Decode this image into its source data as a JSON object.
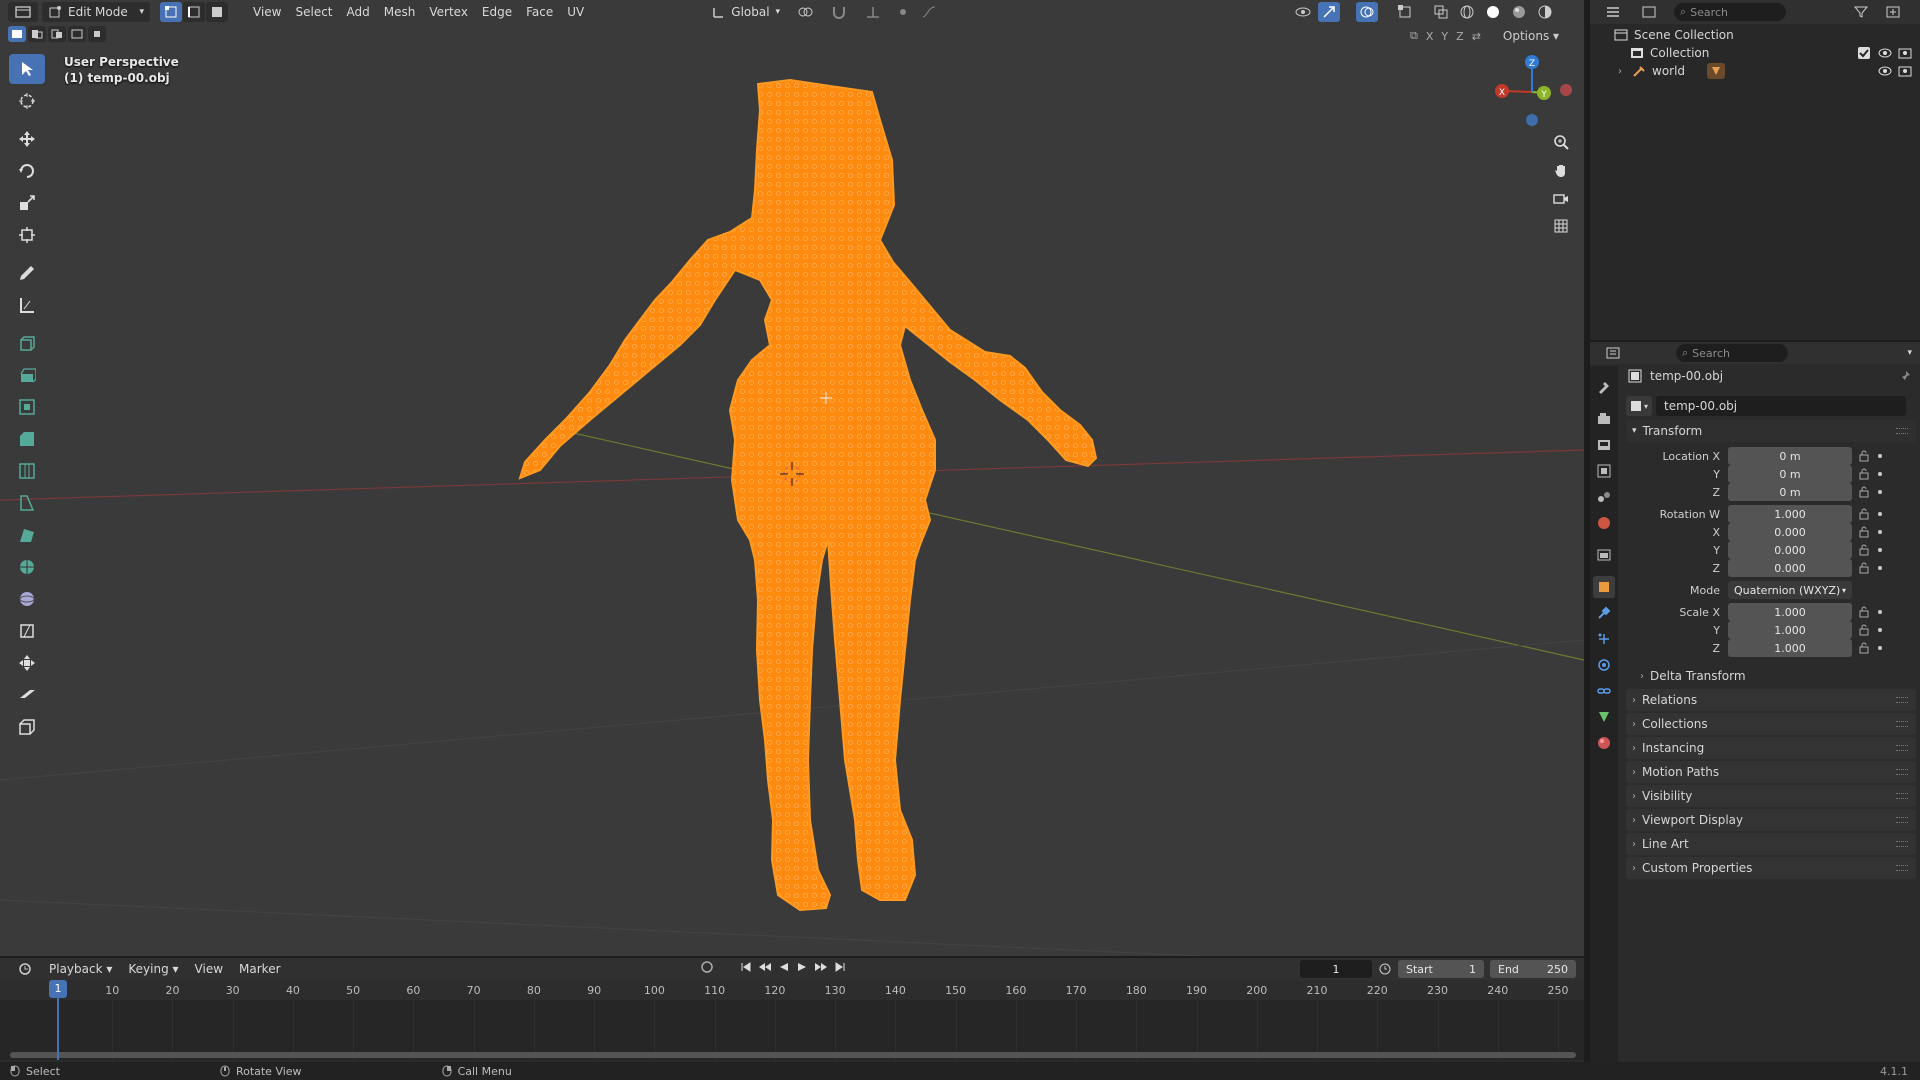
{
  "header": {
    "editor_icon": "editor-type-icon",
    "mode": "Edit Mode",
    "menus": [
      "View",
      "Select",
      "Add",
      "Mesh",
      "Vertex",
      "Edge",
      "Face",
      "UV"
    ],
    "orientation": "Global",
    "options_label": "Options",
    "axis_x": "X",
    "axis_y": "Y",
    "axis_z": "Z"
  },
  "viewport": {
    "perspective": "User Perspective",
    "object_line": "(1) temp-00.obj",
    "mesh_color": "#ff8a10",
    "gizmo": {
      "x": "X",
      "y": "Y",
      "z": "Z"
    }
  },
  "outliner": {
    "search_placeholder": "Search",
    "items": [
      {
        "label": "Scene Collection"
      },
      {
        "label": "Collection"
      },
      {
        "label": "world"
      }
    ]
  },
  "properties": {
    "search_placeholder": "Search",
    "object_name": "temp-00.obj",
    "object_field": "temp-00.obj",
    "transform": {
      "title": "Transform",
      "location_label": "Location X",
      "y_label": "Y",
      "z_label": "Z",
      "location": [
        "0 m",
        "0 m",
        "0 m"
      ],
      "rotation_label": "Rotation W",
      "x_label": "X",
      "rotation": [
        "1.000",
        "0.000",
        "0.000",
        "0.000"
      ],
      "mode_label": "Mode",
      "mode_value": "Quaternion (WXYZ)",
      "scale_label": "Scale X",
      "scale": [
        "1.000",
        "1.000",
        "1.000"
      ],
      "delta": "Delta Transform"
    },
    "panels": [
      "Relations",
      "Collections",
      "Instancing",
      "Motion Paths",
      "Visibility",
      "Viewport Display",
      "Line Art",
      "Custom Properties"
    ]
  },
  "timeline": {
    "menus": [
      "Playback",
      "Keying",
      "View",
      "Marker"
    ],
    "current_frame": "1",
    "start_label": "Start",
    "start": "1",
    "end_label": "End",
    "end": "250",
    "ticks": [
      "1",
      "10",
      "20",
      "30",
      "40",
      "50",
      "60",
      "70",
      "80",
      "90",
      "100",
      "110",
      "120",
      "130",
      "140",
      "150",
      "160",
      "170",
      "180",
      "190",
      "200",
      "210",
      "220",
      "230",
      "240",
      "250"
    ],
    "playhead_label": "1"
  },
  "status": {
    "select": "Select",
    "rotate": "Rotate View",
    "call_menu": "Call Menu",
    "version": "4.1.1"
  },
  "colors": {
    "accent": "#4772b3",
    "mesh": "#ff8a10",
    "x_axis": "#c0392b",
    "y_axis": "#8db52a",
    "z_axis": "#2f7bd5"
  }
}
